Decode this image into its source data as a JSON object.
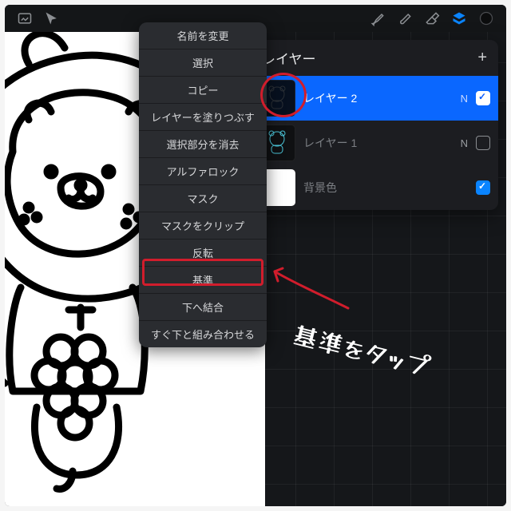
{
  "toolbar": {
    "icons": [
      "gallery",
      "selection",
      "brush",
      "smudge",
      "eraser",
      "layers",
      "color"
    ]
  },
  "layers_panel": {
    "title": "レイヤー",
    "add_label": "+",
    "rows": [
      {
        "name": "レイヤー 2",
        "blend": "N",
        "visible": true,
        "selected": true
      },
      {
        "name": "レイヤー 1",
        "blend": "N",
        "visible": false,
        "selected": false
      },
      {
        "name": "背景色",
        "blend": "",
        "visible": true,
        "selected": false,
        "is_bg": true
      }
    ]
  },
  "context_menu": {
    "items": [
      "名前を変更",
      "選択",
      "コピー",
      "レイヤーを塗りつぶす",
      "選択部分を消去",
      "アルファロック",
      "マスク",
      "マスクをクリップ",
      "反転",
      "基準",
      "下へ結合",
      "すぐ下と組み合わせる"
    ],
    "highlight_index": 9
  },
  "annotation": {
    "handwritten": "基準をタップ"
  }
}
